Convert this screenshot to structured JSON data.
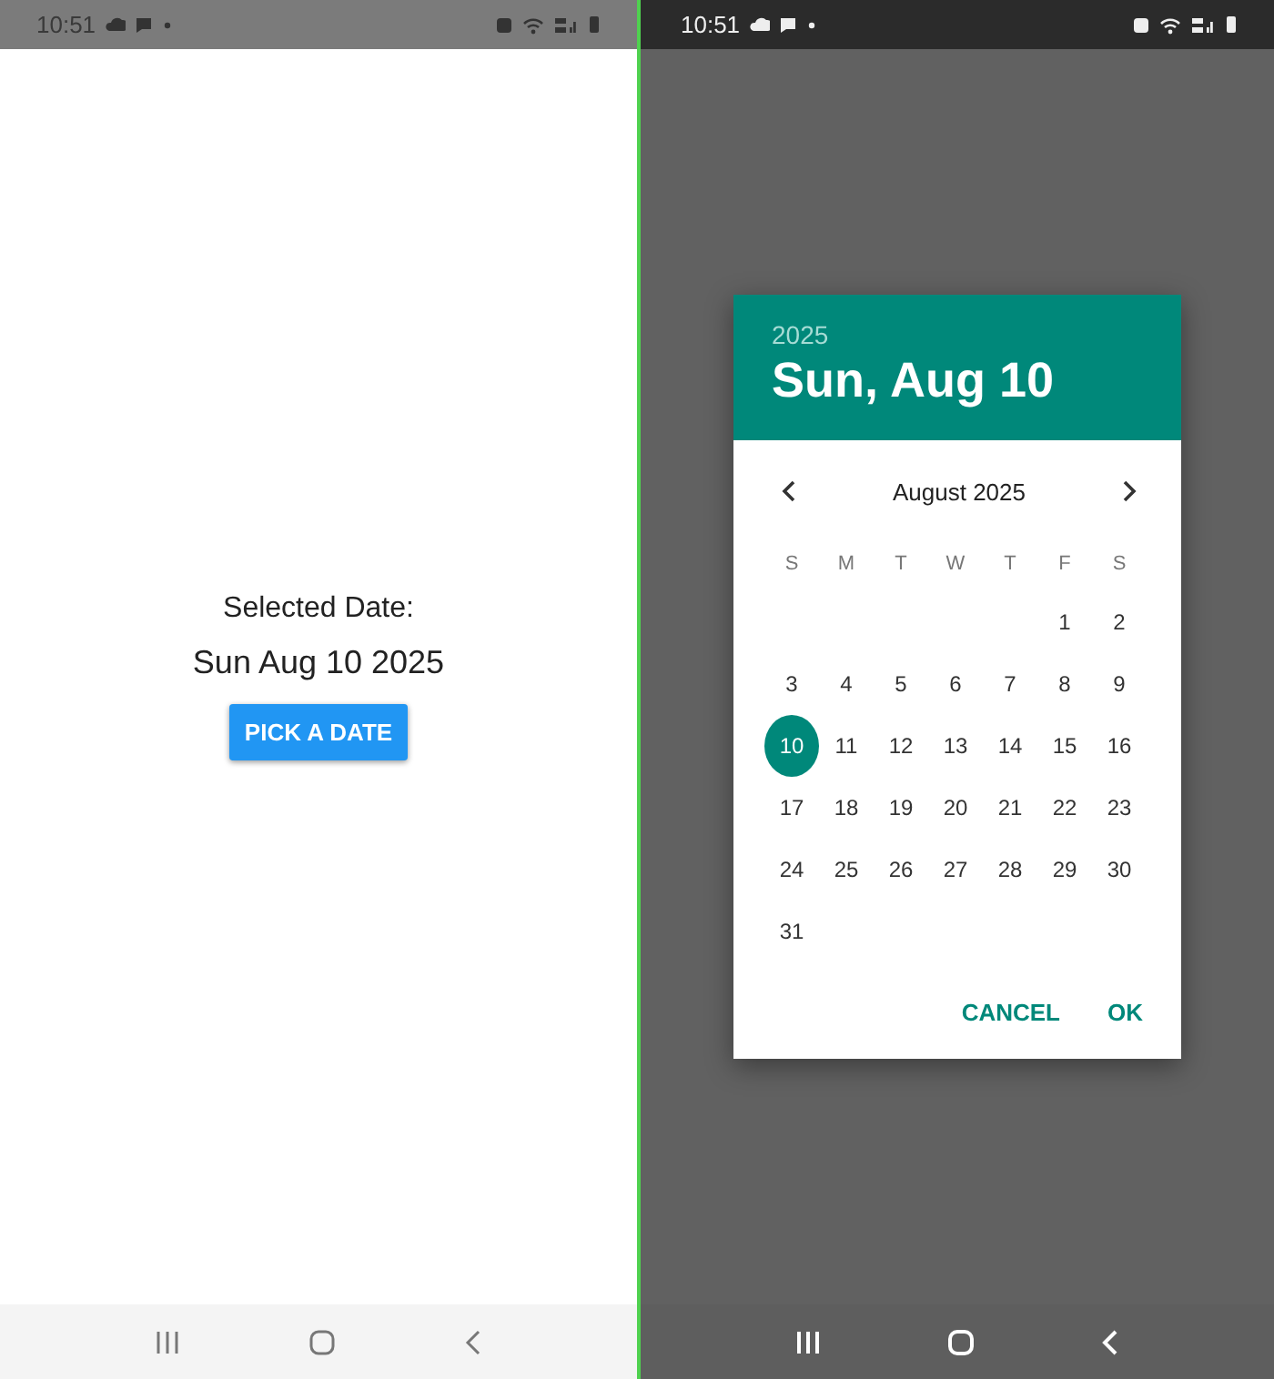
{
  "left_screen": {
    "status_bar": {
      "time": "10:51"
    },
    "label": "Selected Date:",
    "value": "Sun Aug 10 2025",
    "button": "PICK A DATE"
  },
  "right_screen": {
    "status_bar": {
      "time": "10:51"
    },
    "dialog": {
      "year": "2025",
      "date": "Sun, Aug 10",
      "month": "August 2025",
      "weekdays": [
        "S",
        "M",
        "T",
        "W",
        "T",
        "F",
        "S"
      ],
      "weeks": [
        [
          {
            "label": "1",
            "selected": false
          },
          {
            "label": "2",
            "selected": false
          }
        ],
        [
          {
            "label": "3",
            "selected": false
          },
          {
            "label": "4",
            "selected": false
          },
          {
            "label": "5",
            "selected": false
          },
          {
            "label": "6",
            "selected": false
          },
          {
            "label": "7",
            "selected": false
          },
          {
            "label": "8",
            "selected": false
          },
          {
            "label": "9",
            "selected": false
          }
        ],
        [
          {
            "label": "10",
            "selected": true
          },
          {
            "label": "11",
            "selected": false
          },
          {
            "label": "12",
            "selected": false
          },
          {
            "label": "13",
            "selected": false
          },
          {
            "label": "14",
            "selected": false
          },
          {
            "label": "15",
            "selected": false
          },
          {
            "label": "16",
            "selected": false
          }
        ],
        [
          {
            "label": "17",
            "selected": false
          },
          {
            "label": "18",
            "selected": false
          },
          {
            "label": "19",
            "selected": false
          },
          {
            "label": "20",
            "selected": false
          },
          {
            "label": "21",
            "selected": false
          },
          {
            "label": "22",
            "selected": false
          },
          {
            "label": "23",
            "selected": false
          }
        ],
        [
          {
            "label": "24",
            "selected": false
          },
          {
            "label": "25",
            "selected": false
          },
          {
            "label": "26",
            "selected": false
          },
          {
            "label": "27",
            "selected": false
          },
          {
            "label": "28",
            "selected": false
          },
          {
            "label": "29",
            "selected": false
          },
          {
            "label": "30",
            "selected": false
          }
        ],
        [
          {
            "label": "31",
            "selected": false
          }
        ]
      ],
      "buttons": [
        "CANCEL",
        "OK"
      ]
    }
  }
}
